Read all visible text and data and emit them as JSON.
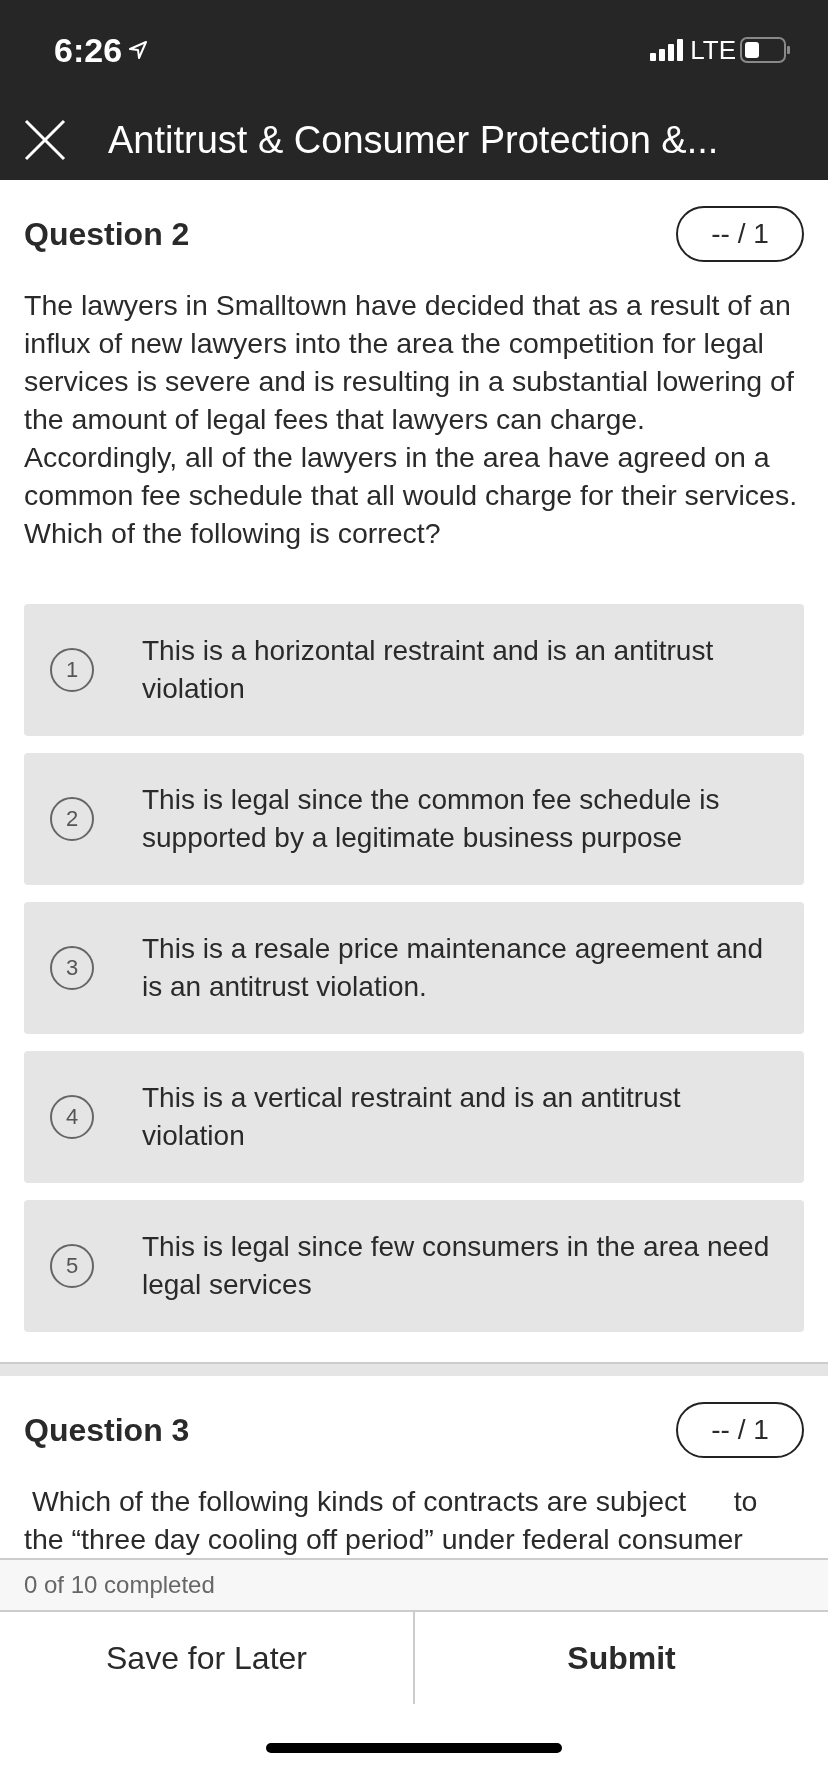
{
  "status_bar": {
    "time": "6:26",
    "network": "LTE"
  },
  "nav": {
    "title": "Antitrust & Consumer Protection &..."
  },
  "questions": [
    {
      "title": "Question 2",
      "score": "-- / 1",
      "text_lines": [
        "The lawyers in Smalltown have decided that as a result of an influx of new lawyers into the area the competition for legal services is severe and is resulting in a substantial lowering of the amount of legal fees that lawyers can charge. Accordingly, all of the lawyers in the area have agreed on a common fee schedule that all would charge for their services. Which of the following is correct?"
      ],
      "options": [
        {
          "number": "1",
          "text": "This is a horizontal restraint and is an antitrust violation",
          "selected": false
        },
        {
          "number": "2",
          "text": "This is legal since the common fee schedule is supported by a legitimate business purpose",
          "selected": false
        },
        {
          "number": "3",
          "text": "This is a resale price maintenance agreement and is an antitrust violation.",
          "selected": false
        },
        {
          "number": "4",
          "text": "This is a vertical restraint and is an antitrust violation",
          "selected": false
        },
        {
          "number": "5",
          "text": "This is legal since few consumers in the area need legal services",
          "selected": false
        }
      ]
    },
    {
      "title": "Question 3",
      "score": "-- / 1",
      "text_lines": [
        " Which of the following kinds of contracts are subject      to",
        "the “three day cooling off period” under federal consumer"
      ]
    }
  ],
  "progress": "0 of 10 completed",
  "buttons": [
    "Save for Later",
    "Submit"
  ]
}
